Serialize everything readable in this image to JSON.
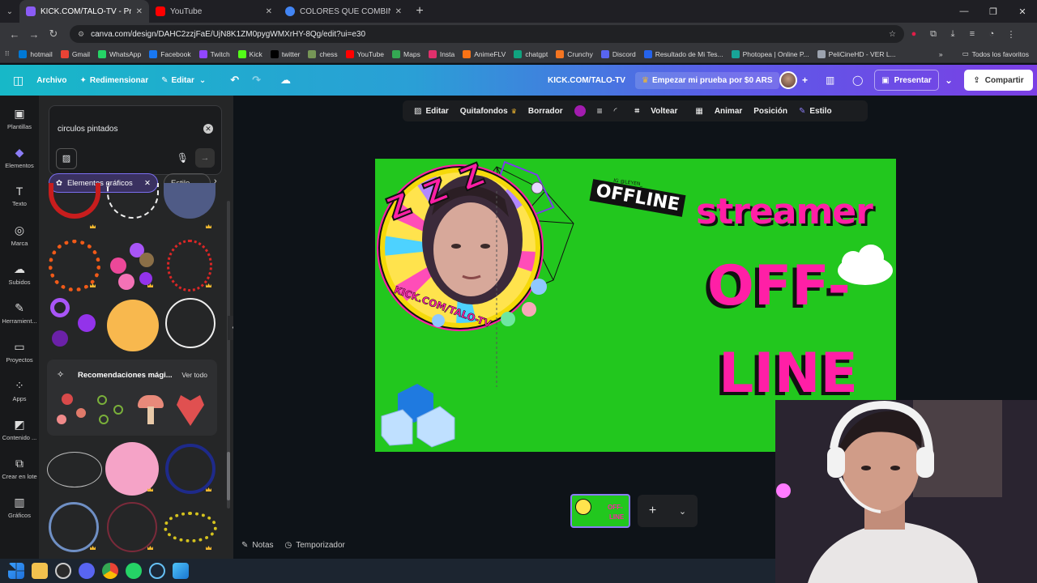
{
  "browser": {
    "tabs": [
      {
        "title": "KICK.COM/TALO-TV - Presentación",
        "color": "#8b5cf6",
        "active": true
      },
      {
        "title": "YouTube",
        "color": "#ff0000",
        "active": false
      },
      {
        "title": "COLORES QUE COMBINAN BIEN",
        "color": "#4285f4",
        "active": false
      }
    ],
    "url": "canva.com/design/DAHC2zzjFaE/UjN8K1ZM0pygWMXrHY-8Qg/edit?ui=e30",
    "bookmarks": [
      "hotmail",
      "Gmail",
      "WhatsApp",
      "Facebook",
      "Twitch",
      "Kick",
      "twitter",
      "chess",
      "YouTube",
      "Maps",
      "Insta",
      "AnimeFLV",
      "chatgpt",
      "Crunchy",
      "Discord",
      "Resultado de Mi Tes...",
      "Photopea | Online P...",
      "PeliCineHD - VER L..."
    ],
    "bookmarks_colors": [
      "#0078d4",
      "#ea4335",
      "#25d366",
      "#1877f2",
      "#9146ff",
      "#53fc18",
      "#000000",
      "#769656",
      "#ff0000",
      "#34a853",
      "#e1306c",
      "#f97316",
      "#10a37f",
      "#f47521",
      "#5865f2",
      "#2563eb",
      "#18a497",
      "#9ca3af"
    ],
    "all_bookmarks": "Todos los favoritos"
  },
  "canva": {
    "menu": {
      "file": "Archivo",
      "resize": "Redimensionar",
      "edit": "Editar"
    },
    "doc_title": "KICK.COM/TALO-TV",
    "trial": "Empezar mi prueba por $0 ARS",
    "present": "Presentar",
    "share": "Compartir",
    "rail": [
      {
        "label": "Plantillas",
        "icon": "▣"
      },
      {
        "label": "Elementos",
        "icon": "◆"
      },
      {
        "label": "Texto",
        "icon": "T"
      },
      {
        "label": "Marca",
        "icon": "◎"
      },
      {
        "label": "Subidos",
        "icon": "☁"
      },
      {
        "label": "Herramient...",
        "icon": "✎"
      },
      {
        "label": "Proyectos",
        "icon": "▭"
      },
      {
        "label": "Apps",
        "icon": "⁘"
      },
      {
        "label": "Contenido ...",
        "icon": "◩"
      },
      {
        "label": "Crear en lote",
        "icon": "⧉"
      },
      {
        "label": "Gráficos",
        "icon": "▥"
      }
    ],
    "search": {
      "query": "circulos pintados"
    },
    "chips": {
      "selected": "Elementos gráficos",
      "style": "Estilo"
    },
    "magic": {
      "title": "Recomendaciones mági...",
      "see_all": "Ver todo"
    },
    "context_toolbar": [
      "Editar",
      "Quitafondos",
      "Borrador",
      "Voltear",
      "Animar",
      "Posición",
      "Estilo"
    ],
    "accent_color": "#a21caf",
    "design": {
      "handle_label": "IG @LEYEN_",
      "offline_badge": "OFFLINE",
      "streamer": "streamer",
      "off": "OFF-",
      "line": "LINE",
      "zzz": "Z Z Z",
      "kick_text": "KICK.COM/TALO-TV",
      "bg_color": "#22c71e",
      "pink": "#ff1fa6"
    },
    "page_thumb": {
      "line1": "OFF-",
      "line2": "LINE"
    },
    "footer": {
      "notes": "Notas",
      "timer": "Temporizador"
    }
  }
}
